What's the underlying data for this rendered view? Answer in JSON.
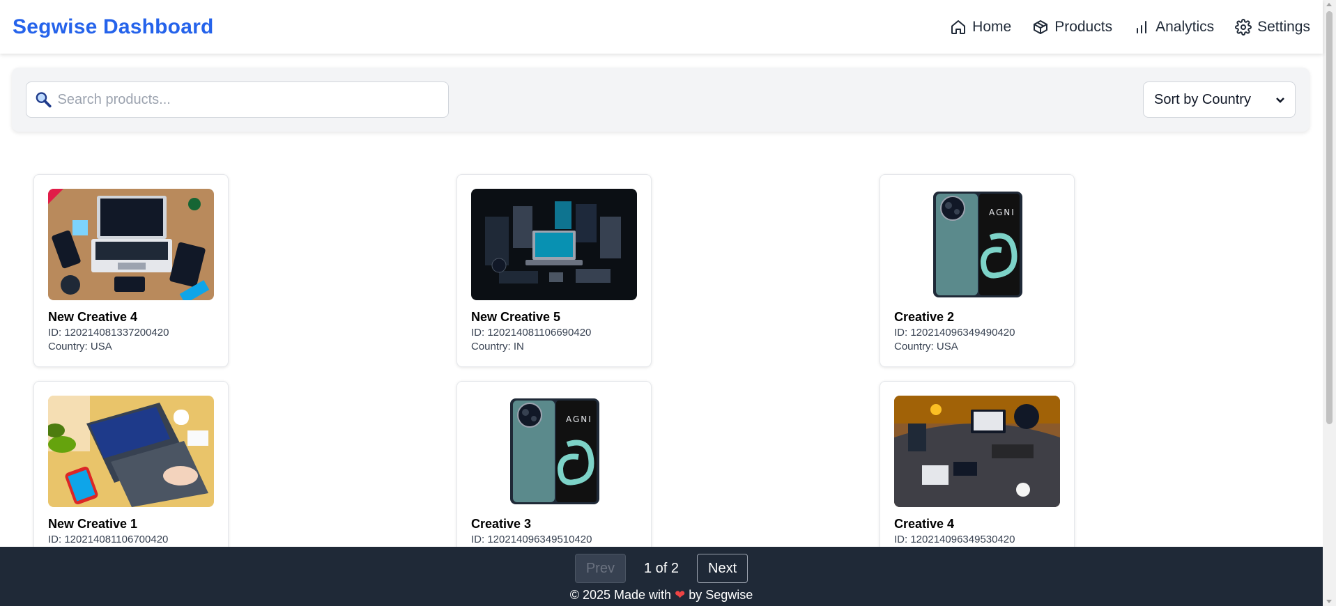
{
  "header": {
    "brand": "Segwise Dashboard",
    "nav": [
      {
        "label": "Home",
        "icon": "home-icon"
      },
      {
        "label": "Products",
        "icon": "box-icon"
      },
      {
        "label": "Analytics",
        "icon": "bar-chart-icon"
      },
      {
        "label": "Settings",
        "icon": "gear-icon"
      }
    ]
  },
  "filters": {
    "search_placeholder": "Search products...",
    "sort_selected": "Sort by Country"
  },
  "products": [
    {
      "title": "New Creative 4",
      "id": "ID: 120214081337200420",
      "country": "Country: USA",
      "image": "laptop-desk-flatlay-image"
    },
    {
      "title": "New Creative 5",
      "id": "ID: 120214081106690420",
      "country": "Country: IN",
      "image": "dark-tech-setup-image"
    },
    {
      "title": "Creative 2",
      "id": "ID: 120214096349490420",
      "country": "Country: USA",
      "image": "agni-phone-image"
    },
    {
      "title": "New Creative 1",
      "id": "ID: 120214081106700420",
      "country": "",
      "image": "laptop-hands-image"
    },
    {
      "title": "Creative 3",
      "id": "ID: 120214096349510420",
      "country": "",
      "image": "agni-phone-image"
    },
    {
      "title": "Creative 4",
      "id": "ID: 120214096349530420",
      "country": "",
      "image": "office-desk-overhead-image"
    }
  ],
  "pagination": {
    "prev": "Prev",
    "info": "1 of 2",
    "next": "Next"
  },
  "footer": {
    "copy_before": "© 2025 Made with",
    "heart": "❤",
    "copy_after": "by Segwise"
  },
  "colors": {
    "brand": "#2563eb",
    "footer_bg": "#1f2937",
    "heart": "#ef4444"
  }
}
